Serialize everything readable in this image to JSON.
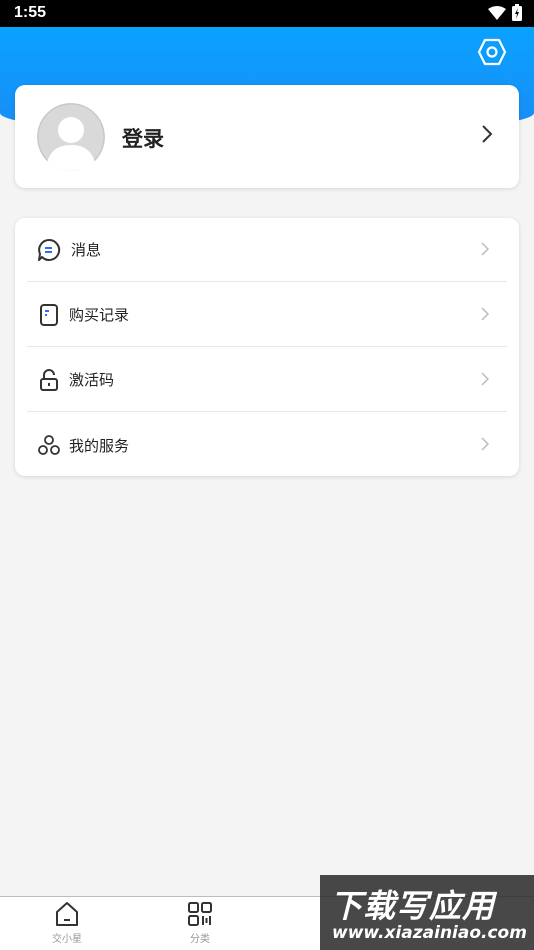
{
  "status_bar": {
    "time": "1:55"
  },
  "profile": {
    "login_label": "登录"
  },
  "menu": {
    "items": [
      {
        "label": "消息",
        "icon": "message-icon"
      },
      {
        "label": "购买记录",
        "icon": "receipt-icon"
      },
      {
        "label": "激活码",
        "icon": "lock-icon"
      },
      {
        "label": "我的服务",
        "icon": "services-icon"
      }
    ]
  },
  "bottom_nav": {
    "tabs": [
      {
        "label": "交小星",
        "icon": "home-icon"
      },
      {
        "label": "分类",
        "icon": "category-icon"
      }
    ]
  },
  "watermark": {
    "title": "下载写应用",
    "url": "www.xiazainiao.com"
  },
  "colors": {
    "header_blue": "#0aa2ff",
    "accent": "#1a8bf5"
  }
}
